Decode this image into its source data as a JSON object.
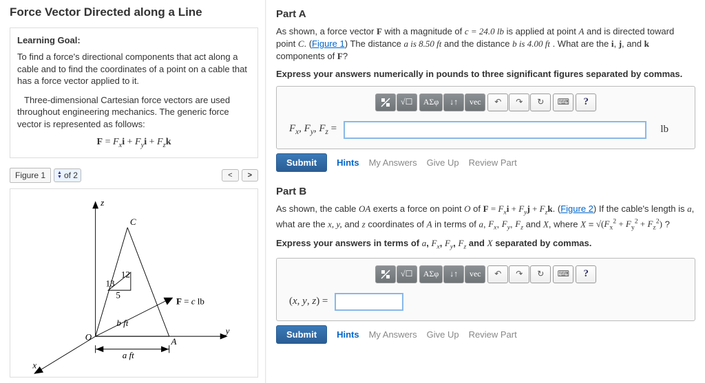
{
  "left": {
    "title": "Force Vector Directed along a Line",
    "goal_head": "Learning Goal:",
    "goal1": "To find a force's directional components that act along a cable and to find the coordinates of a point on a cable that has a force vector applied to it.",
    "goal2": "Three-dimensional Cartesian force vectors are used throughout engineering mechanics. The generic force vector is represented as follows:",
    "fig_label": "Figure 1",
    "fig_of": "of 2",
    "prev": "<",
    "next": ">",
    "diagram": {
      "z": "z",
      "y": "y",
      "x": "x",
      "C": "C",
      "O": "O",
      "A": "A",
      "v13": "13",
      "v12": "12",
      "v5": "5",
      "b": "b ft",
      "a": "a ft",
      "F": "F = c lb"
    }
  },
  "partA": {
    "head": "Part A",
    "magnitude": "c = 24.0 lb",
    "dist_a": "a is 8.50 ft",
    "dist_b": "b is 4.00 ft",
    "fig_link": "Figure 1",
    "instruct": "Express your answers numerically in pounds to three significant figures separated by commas.",
    "unit": "lb",
    "submit": "Submit",
    "hints": "Hints",
    "my_answers": "My Answers",
    "give_up": "Give Up",
    "review": "Review Part"
  },
  "partB": {
    "head": "Part B",
    "fig_link": "Figure 2",
    "instruct_lead": "Express your answers in terms of",
    "instruct_tail": "separated by commas.",
    "submit": "Submit",
    "hints": "Hints",
    "my_answers": "My Answers",
    "give_up": "Give Up",
    "review": "Review Part"
  },
  "toolbar": {
    "templates": "ΑΣφ",
    "vec": "vec",
    "q": "?"
  }
}
